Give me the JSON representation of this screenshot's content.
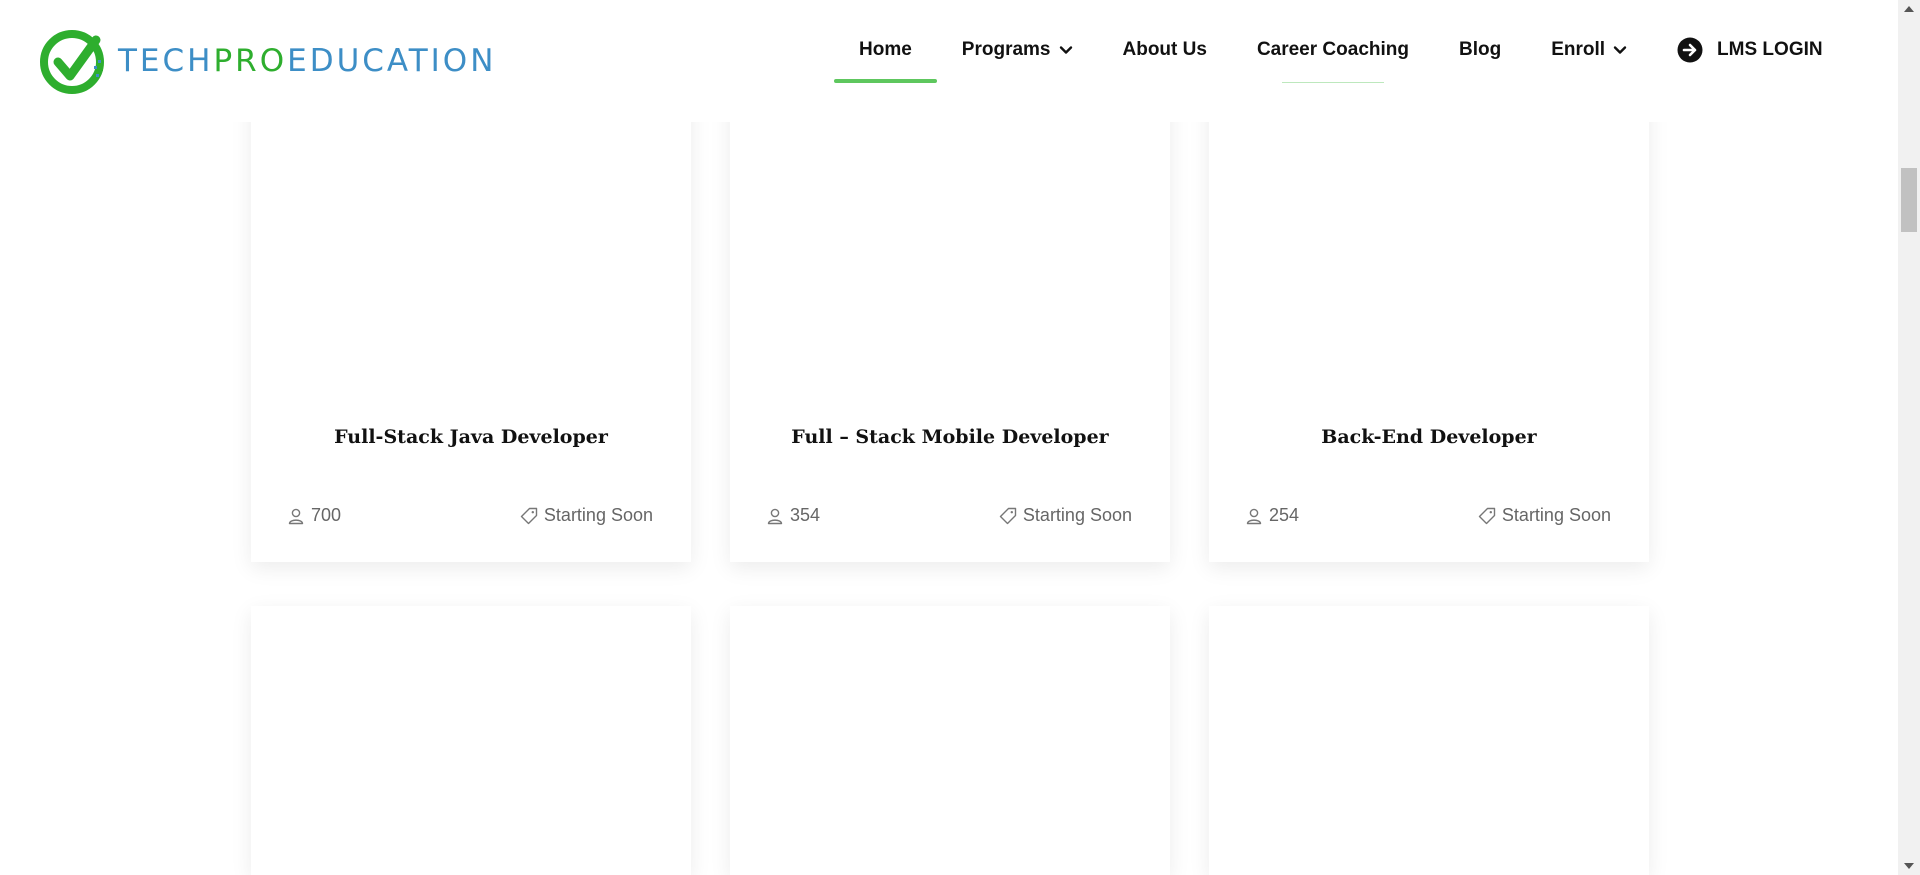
{
  "brand": {
    "logo_text_part1": "TECH",
    "logo_text_part2": "PRO",
    "logo_text_part3": "EDUCATION",
    "colors": {
      "blue": "#3d8ec6",
      "green": "#2eae2e",
      "accent": "#5ec75e"
    }
  },
  "nav": {
    "home": "Home",
    "programs": "Programs",
    "about": "About Us",
    "career": "Career Coaching",
    "blog": "Blog",
    "enroll": "Enroll",
    "lms": "LMS LOGIN"
  },
  "icons": {
    "programs_caret": "chevron-down-icon",
    "enroll_caret": "chevron-down-icon",
    "lms": "arrow-right-circle-icon",
    "students": "user-icon",
    "status": "tag-icon"
  },
  "courses": [
    {
      "title": "Full-Stack Java Developer",
      "students": "700",
      "status": "Starting Soon"
    },
    {
      "title": "Full – Stack Mobile Developer",
      "students": "354",
      "status": "Starting Soon"
    },
    {
      "title": "Back-End Developer",
      "students": "254",
      "status": "Starting Soon"
    }
  ]
}
